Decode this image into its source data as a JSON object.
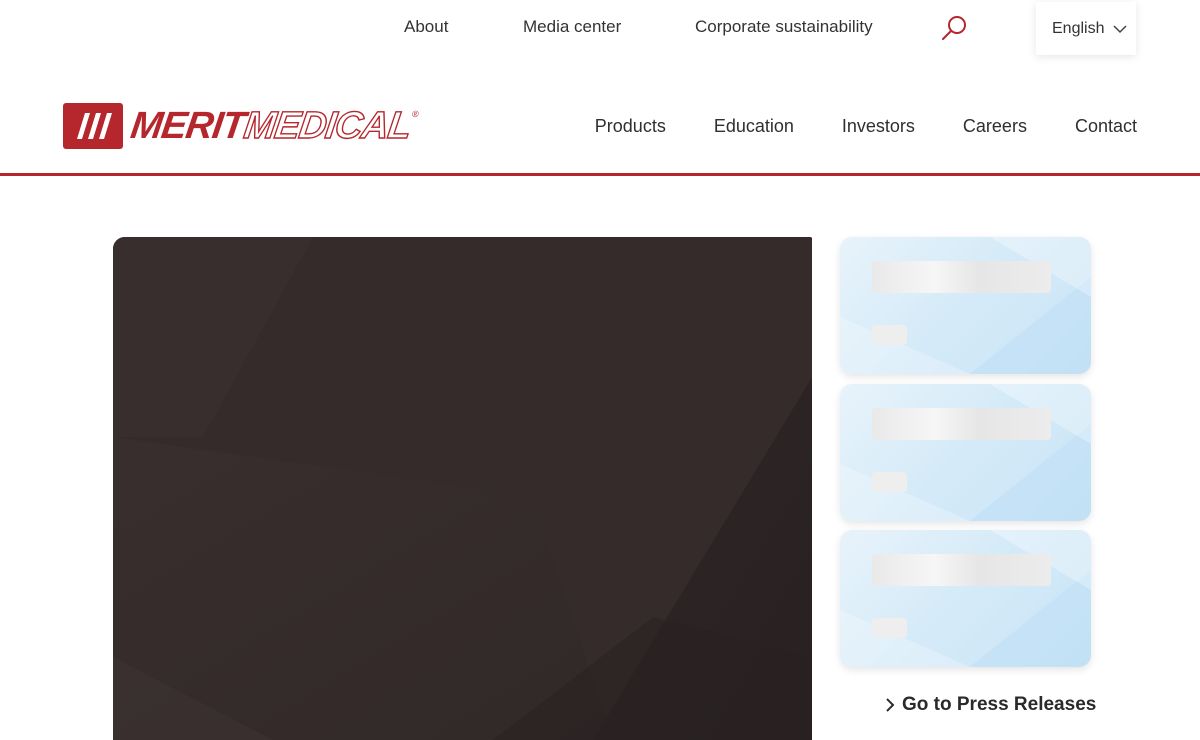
{
  "utility_nav": {
    "about": "About",
    "media_center": "Media center",
    "corporate_sustainability": "Corporate sustainability",
    "search_icon": "search-icon",
    "language": "English",
    "language_icon": "chevron-down-icon"
  },
  "brand": {
    "name_part1": "MERIT",
    "name_part2": "MEDICAL",
    "registered": "®",
    "brand_color": "#b5272d"
  },
  "main_nav": {
    "items": [
      "Products",
      "Education",
      "Investors",
      "Careers",
      "Contact"
    ]
  },
  "hero": {
    "background_color": "#352b2b"
  },
  "press_cards": {
    "count": 3,
    "state": "loading-placeholder"
  },
  "press_link": {
    "label": "Go to Press Releases",
    "icon": "chevron-right-icon"
  },
  "colors": {
    "accent": "#b5272d",
    "card_blue": "#c7e3f6",
    "text": "#2b2b2b"
  }
}
